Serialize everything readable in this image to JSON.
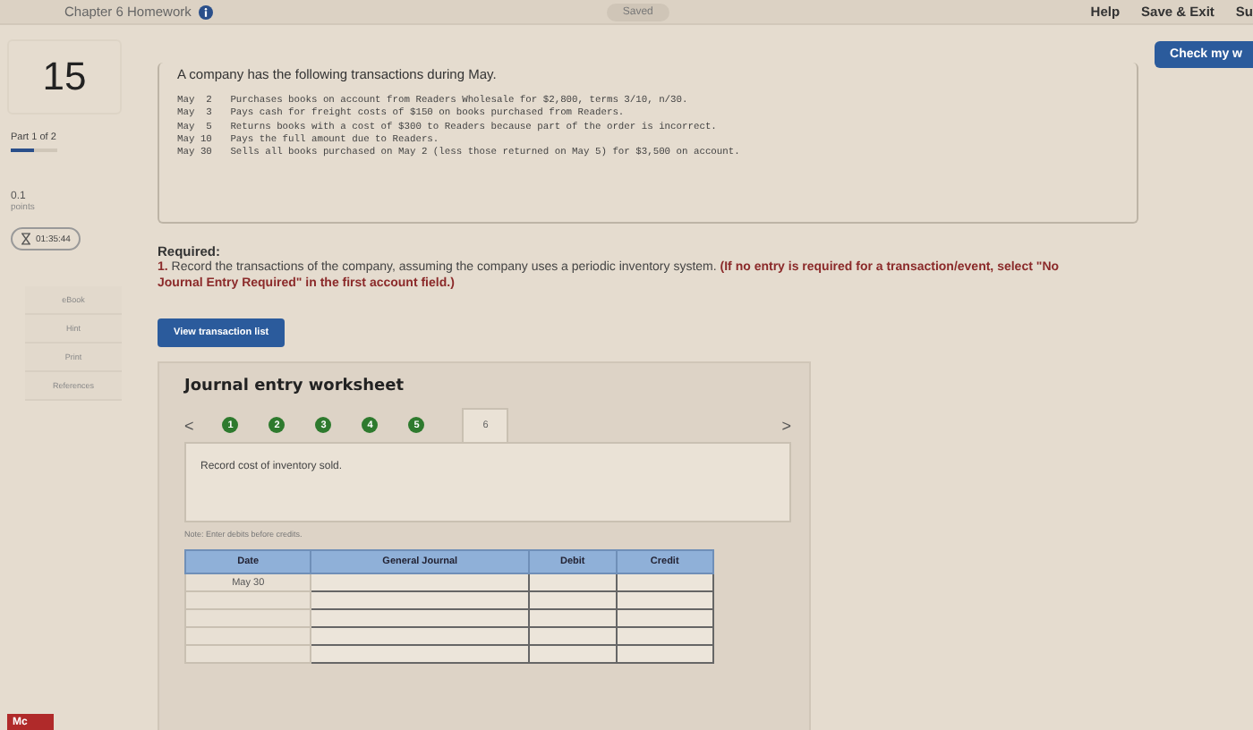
{
  "top_bar": {
    "title": "Chapter 6 Homework",
    "status": "Saved",
    "links": [
      "Help",
      "Save & Exit",
      "Su"
    ]
  },
  "check_button": "Check my w",
  "question": {
    "number": "15",
    "part": "Part 1 of 2",
    "progress": {
      "level": 0.5
    },
    "points": "0.1",
    "points_label": "points",
    "timer": "01:35:44"
  },
  "side_links": [
    "eBook",
    "Hint",
    "Print",
    "References"
  ],
  "intro": "A company has the following transactions during May.",
  "transactions": [
    {
      "date": "May  2",
      "text": "Purchases books on account from Readers Wholesale for $2,800, terms 3/10, n/30."
    },
    {
      "date": "May  3",
      "text": "Pays cash for freight costs of $150 on books purchased from Readers."
    },
    {
      "date": "May  5",
      "text": "Returns books with a cost of $300 to Readers because part of the order is incorrect."
    },
    {
      "date": "May 10",
      "text": "Pays the full amount due to Readers."
    },
    {
      "date": "May 30",
      "text": "Sells all books purchased on May 2 (less those returned on May 5) for $3,500 on account."
    }
  ],
  "required": {
    "heading": "Required:",
    "text": "**1.** Record the transactions of the company, assuming the company uses a periodic inventory system. **(If no entry is required for a transaction/event, select \"No Journal Entry Required\" in the first account field.)**"
  },
  "view_button": "View transaction list",
  "worksheet": {
    "title": "Journal entry worksheet",
    "prev": "<",
    "next": ">",
    "steps": [
      {
        "label": "1",
        "selected": false
      },
      {
        "label": "2",
        "selected": false
      },
      {
        "label": "3",
        "selected": false
      },
      {
        "label": "4",
        "selected": false
      },
      {
        "label": "5",
        "selected": false
      },
      {
        "label": "6",
        "selected": true
      }
    ],
    "instruction": "Record cost of inventory sold.",
    "note": "Note: Enter debits before credits.",
    "columns": [
      "Date",
      "General Journal",
      "Debit",
      "Credit"
    ],
    "rows": [
      {
        "date": "May 30"
      },
      {},
      {},
      {},
      {}
    ]
  },
  "logo": "Mc"
}
